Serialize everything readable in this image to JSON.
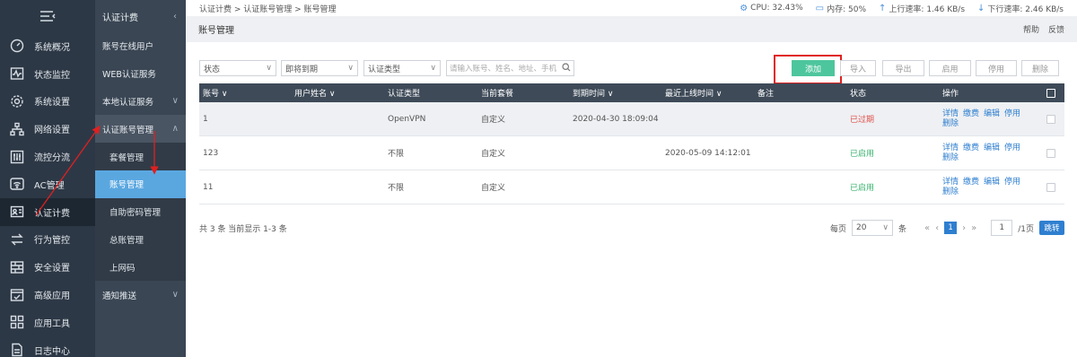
{
  "sidebar": {
    "items": [
      {
        "label": "系统概况",
        "icon": "gauge-icon"
      },
      {
        "label": "状态监控",
        "icon": "monitor-pulse-icon"
      },
      {
        "label": "系统设置",
        "icon": "gear-icon"
      },
      {
        "label": "网络设置",
        "icon": "network-icon"
      },
      {
        "label": "流控分流",
        "icon": "sliders-icon"
      },
      {
        "label": "AC管理",
        "icon": "wifi-icon"
      },
      {
        "label": "认证计费",
        "icon": "id-card-icon",
        "active": true
      },
      {
        "label": "行为管控",
        "icon": "exchange-icon"
      },
      {
        "label": "安全设置",
        "icon": "firewall-icon"
      },
      {
        "label": "高级应用",
        "icon": "check-window-icon"
      },
      {
        "label": "应用工具",
        "icon": "apps-grid-icon"
      },
      {
        "label": "日志中心",
        "icon": "document-icon"
      }
    ]
  },
  "subnav": {
    "header": "认证计费",
    "items": [
      "账号在线用户",
      "WEB认证服务",
      "本地认证服务",
      "认证账号管理"
    ],
    "children": [
      "套餐管理",
      "账号管理",
      "自助密码管理",
      "总账管理",
      "上网码"
    ],
    "after": [
      "通知推送"
    ]
  },
  "topbar": {
    "breadcrumb": "认证计费 > 认证账号管理 > 账号管理",
    "cpu": "CPU: 32.43%",
    "mem": "内存: 50%",
    "up": "上行速率: 1.46 KB/s",
    "down": "下行速率: 2.46 KB/s"
  },
  "title": {
    "text": "账号管理",
    "help": "帮助",
    "feedback": "反馈"
  },
  "toolbar": {
    "filters": [
      "状态",
      "即将到期",
      "认证类型"
    ],
    "search_placeholder": "请输入账号、姓名、地址、手机",
    "add": "添加",
    "import": "导入",
    "export": "导出",
    "enable": "启用",
    "disable": "停用",
    "delete": "删除"
  },
  "table": {
    "headers": [
      "账号",
      "用户姓名",
      "认证类型",
      "当前套餐",
      "到期时间",
      "最近上线时间",
      "备注",
      "状态",
      "操作"
    ],
    "rows": [
      {
        "account": "1",
        "name": "",
        "auth": "OpenVPN",
        "plan": "自定义",
        "expire": "2020-04-30 18:09:04",
        "last": "",
        "note": "",
        "status": "已过期",
        "status_color": "#e0504a"
      },
      {
        "account": "123",
        "name": "",
        "auth": "不限",
        "plan": "自定义",
        "expire": "",
        "last": "2020-05-09 14:12:01",
        "note": "",
        "status": "已启用",
        "status_color": "#3bb36f"
      },
      {
        "account": "11",
        "name": "",
        "auth": "不限",
        "plan": "自定义",
        "expire": "",
        "last": "",
        "note": "",
        "status": "已启用",
        "status_color": "#3bb36f"
      }
    ],
    "ops": [
      "详情",
      "缴费",
      "编辑",
      "停用",
      "删除"
    ]
  },
  "footer": {
    "summary": "共 3 条 当前显示 1-3 条",
    "per_page_label": "每页",
    "per_page": "20",
    "unit": "条",
    "current_page": "1",
    "page_input": "1",
    "total_pages": "/1页",
    "go": "跳转"
  },
  "colors": {
    "accent": "#2f7fd0",
    "primary_button": "#4ec69d",
    "sidebar": "#2d3846",
    "highlight": "#e02020"
  }
}
